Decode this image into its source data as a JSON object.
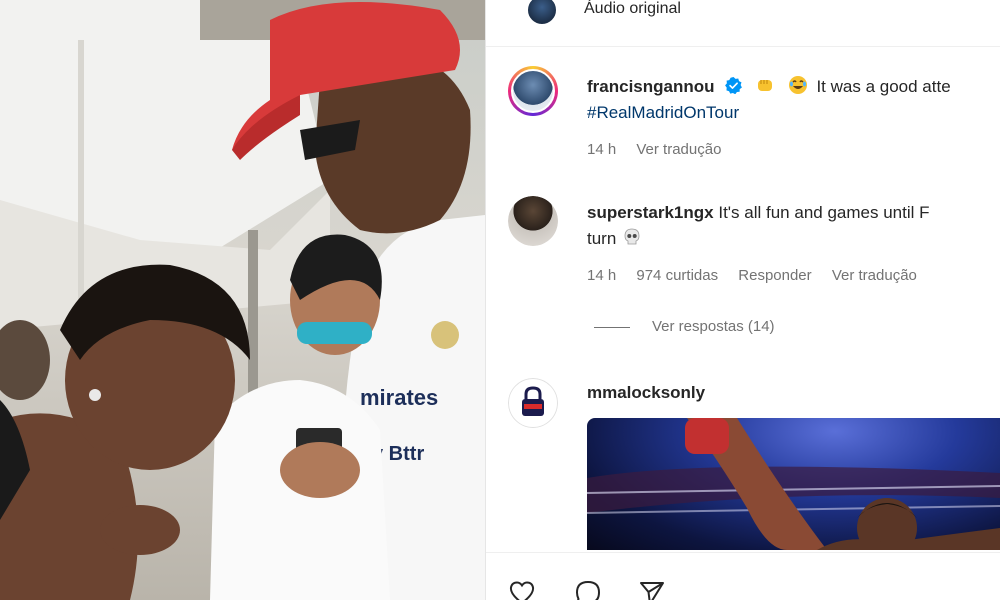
{
  "audio": {
    "label": "Áudio original"
  },
  "comments": [
    {
      "username": "francisngannou",
      "text": "It was a good atte",
      "hashtag": "#RealMadridOnTour",
      "time": "14 h",
      "translate": "Ver tradução"
    },
    {
      "username": "superstark1ngx",
      "text": "It's all fun and games until F",
      "text_line2": "turn",
      "time": "14 h",
      "likes": "974 curtidas",
      "reply": "Responder",
      "translate": "Ver tradução"
    },
    {
      "username": "mmalocksonly"
    }
  ],
  "view_replies": "Ver respostas (14)",
  "colors": {
    "link": "#00376b",
    "muted": "#737373",
    "verified": "#0095f6",
    "text": "#262626"
  },
  "icons": {
    "verified": "verified-badge-icon",
    "like": "heart-icon",
    "comment": "comment-icon",
    "share": "send-icon"
  }
}
